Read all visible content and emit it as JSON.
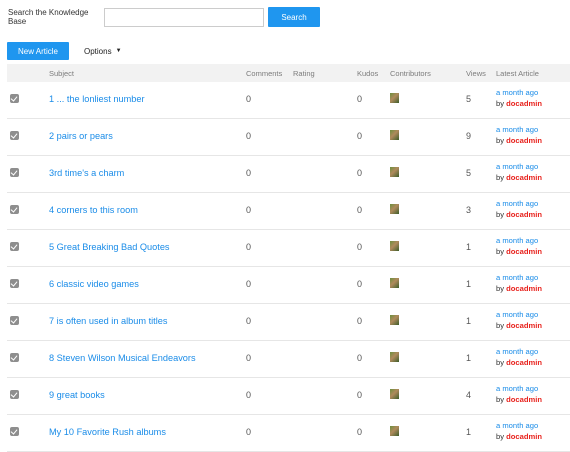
{
  "search": {
    "label": "Search the Knowledge Base",
    "placeholder": "",
    "value": "",
    "button_label": "Search"
  },
  "toolbar": {
    "new_article_label": "New Article",
    "options_label": "Options"
  },
  "colors": {
    "accent": "#1f96ef",
    "link": "#1a8ce8",
    "author": "#e8231e"
  },
  "table": {
    "headers": {
      "subject": "Subject",
      "comments": "Comments",
      "rating": "Rating",
      "kudos": "Kudos",
      "contributors": "Contributors",
      "views": "Views",
      "latest": "Latest Article"
    },
    "rows": [
      {
        "subject": "1 ... the lonliest number",
        "comments": "0",
        "kudos": "0",
        "views": "5",
        "ago": "a month ago",
        "by": "by",
        "author": "docadmin"
      },
      {
        "subject": "2 pairs or pears",
        "comments": "0",
        "kudos": "0",
        "views": "9",
        "ago": "a month ago",
        "by": "by",
        "author": "docadmin"
      },
      {
        "subject": "3rd time's a charm",
        "comments": "0",
        "kudos": "0",
        "views": "5",
        "ago": "a month ago",
        "by": "by",
        "author": "docadmin"
      },
      {
        "subject": "4 corners to this room",
        "comments": "0",
        "kudos": "0",
        "views": "3",
        "ago": "a month ago",
        "by": "by",
        "author": "docadmin"
      },
      {
        "subject": "5 Great Breaking Bad Quotes",
        "comments": "0",
        "kudos": "0",
        "views": "1",
        "ago": "a month ago",
        "by": "by",
        "author": "docadmin"
      },
      {
        "subject": "6 classic video games",
        "comments": "0",
        "kudos": "0",
        "views": "1",
        "ago": "a month ago",
        "by": "by",
        "author": "docadmin"
      },
      {
        "subject": "7 is often used in album titles",
        "comments": "0",
        "kudos": "0",
        "views": "1",
        "ago": "a month ago",
        "by": "by",
        "author": "docadmin"
      },
      {
        "subject": "8 Steven Wilson Musical Endeavors",
        "comments": "0",
        "kudos": "0",
        "views": "1",
        "ago": "a month ago",
        "by": "by",
        "author": "docadmin"
      },
      {
        "subject": "9 great books",
        "comments": "0",
        "kudos": "0",
        "views": "4",
        "ago": "a month ago",
        "by": "by",
        "author": "docadmin"
      },
      {
        "subject": "My 10 Favorite Rush albums",
        "comments": "0",
        "kudos": "0",
        "views": "1",
        "ago": "a month ago",
        "by": "by",
        "author": "docadmin"
      }
    ]
  }
}
